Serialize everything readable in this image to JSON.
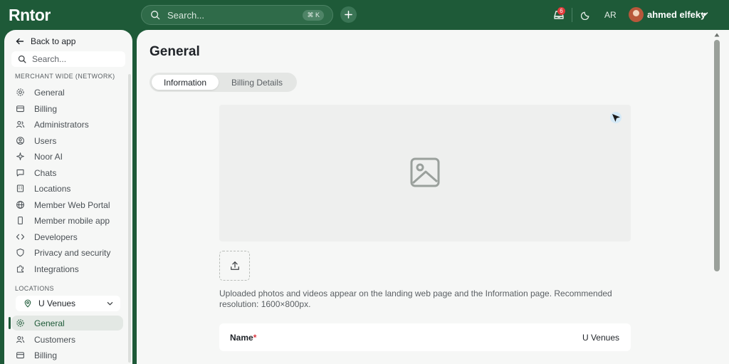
{
  "app": {
    "logo": "Rntor"
  },
  "topbar": {
    "search_placeholder": "Search...",
    "search_shortcut": "⌘ K",
    "notifications_count": "6",
    "language": "AR",
    "user_name": "ahmed elfeky"
  },
  "sidebar": {
    "back_label": "Back to app",
    "search_placeholder": "Search...",
    "section_network": "MERCHANT WIDE (NETWORK)",
    "network_items": [
      {
        "label": "General",
        "icon": "gear-icon"
      },
      {
        "label": "Billing",
        "icon": "wallet-icon"
      },
      {
        "label": "Administrators",
        "icon": "users-icon"
      },
      {
        "label": "Users",
        "icon": "user-circle-icon"
      },
      {
        "label": "Noor AI",
        "icon": "sparkles-icon"
      },
      {
        "label": "Chats",
        "icon": "chat-icon"
      },
      {
        "label": "Locations",
        "icon": "building-icon"
      },
      {
        "label": "Member Web Portal",
        "icon": "globe-icon"
      },
      {
        "label": "Member mobile app",
        "icon": "phone-icon"
      },
      {
        "label": "Developers",
        "icon": "code-icon"
      },
      {
        "label": "Privacy and security",
        "icon": "shield-icon"
      },
      {
        "label": "Integrations",
        "icon": "puzzle-icon"
      }
    ],
    "section_locations": "LOCATIONS",
    "location_selected": "U Venues",
    "location_items": [
      {
        "label": "General",
        "icon": "gear-icon",
        "active": true
      },
      {
        "label": "Customers",
        "icon": "users-icon"
      },
      {
        "label": "Billing",
        "icon": "wallet-icon"
      }
    ]
  },
  "main": {
    "title": "General",
    "tabs": [
      {
        "label": "Information",
        "active": true
      },
      {
        "label": "Billing Details",
        "active": false
      }
    ],
    "help_text": "Uploaded photos and videos appear on the landing web page and the Information page. Recommended resolution: 1600×800px.",
    "name_label": "Name",
    "name_required_mark": "*",
    "name_value": "U Venues"
  },
  "colors": {
    "brand_green": "#1e5a38",
    "required_red": "#d9363e",
    "badge_red": "#e03b3b"
  }
}
